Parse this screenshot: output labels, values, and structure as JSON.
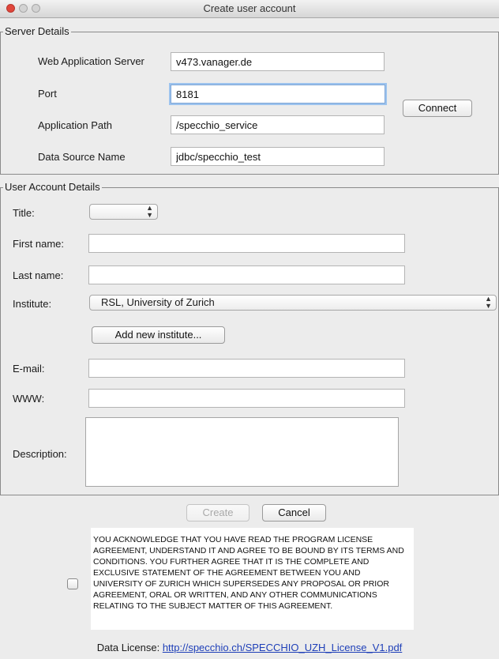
{
  "window": {
    "title": "Create user account"
  },
  "server_details": {
    "legend": "Server Details",
    "web_app_server_label": "Web Application Server",
    "web_app_server_value": "v473.vanager.de",
    "port_label": "Port",
    "port_value": "8181",
    "app_path_label": "Application Path",
    "app_path_value": "/specchio_service",
    "data_source_label": "Data Source Name",
    "data_source_value": "jdbc/specchio_test",
    "connect_label": "Connect"
  },
  "user_details": {
    "legend": "User Account Details",
    "title_label": "Title:",
    "title_value": "",
    "first_name_label": "First name:",
    "first_name_value": "",
    "last_name_label": "Last name:",
    "last_name_value": "",
    "institute_label": "Institute:",
    "institute_value": "RSL, University of Zurich",
    "add_institute_label": "Add new institute...",
    "email_label": "E-mail:",
    "email_value": "",
    "www_label": "WWW:",
    "www_value": "",
    "description_label": "Description:",
    "description_value": ""
  },
  "actions": {
    "create_label": "Create",
    "cancel_label": "Cancel"
  },
  "license": {
    "agreement_text": "YOU ACKNOWLEDGE THAT YOU HAVE READ THE PROGRAM LICENSE\nAGREEMENT, UNDERSTAND IT AND AGREE TO BE BOUND BY ITS TERMS AND\nCONDITIONS.  YOU FURTHER AGREE THAT IT IS THE COMPLETE AND\nEXCLUSIVE STATEMENT OF THE AGREEMENT BETWEEN YOU AND\nUNIVERSITY OF ZURICH WHICH SUPERSEDES ANY PROPOSAL OR PRIOR\nAGREEMENT, ORAL OR WRITTEN, AND ANY OTHER COMMUNICATIONS\nRELATING TO THE SUBJECT MATTER OF THIS AGREEMENT.",
    "agree_checked": false,
    "data_license_label": "Data License:",
    "data_license_url": "http://specchio.ch/SPECCHIO_UZH_License_V1.pdf"
  },
  "colors": {
    "close_button": "#e0463b",
    "link": "#1e3fb8",
    "focus_ring": "#9cc3ee"
  }
}
